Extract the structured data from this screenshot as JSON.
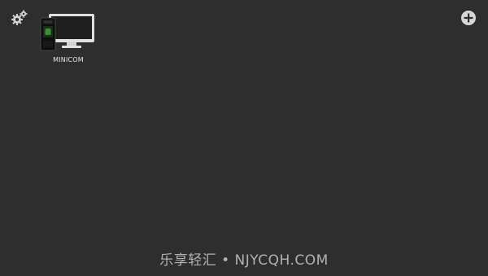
{
  "toolbar": {
    "settings_icon": "gears-icon",
    "add_icon": "plus-circle-icon"
  },
  "devices": [
    {
      "name": "MINICOM",
      "icon": "kvm-monitor-icon"
    }
  ],
  "watermark": {
    "text": "乐享轻汇 • NJYCQH.COM"
  },
  "colors": {
    "background": "#2e2e2e",
    "icon": "#d8d8d8",
    "accent": "#3c8c3c"
  }
}
